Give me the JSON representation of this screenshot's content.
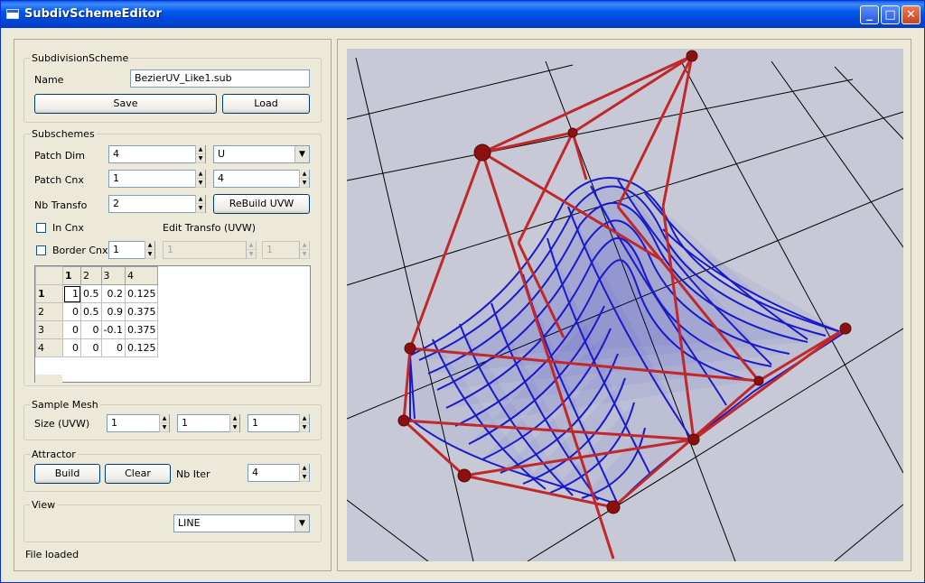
{
  "window": {
    "title": "SubdivSchemeEditor"
  },
  "subdivision_scheme": {
    "legend": "SubdivisionScheme",
    "name_label": "Name",
    "name_value": "BezierUV_Like1.sub",
    "save_label": "Save",
    "load_label": "Load"
  },
  "subschemes": {
    "legend": "Subschemes",
    "patch_dim_label": "Patch Dim",
    "patch_dim_value": "4",
    "patch_dim_axis": "U",
    "patch_cnx_label": "Patch Cnx",
    "patch_cnx_value": "1",
    "patch_cnx_value2": "4",
    "nb_transfo_label": "Nb Transfo",
    "nb_transfo_value": "2",
    "rebuild_label": "ReBuild UVW",
    "in_cnx_label": "In Cnx",
    "edit_transfo_label": "Edit Transfo (UVW)",
    "border_cnx_label": "Border Cnx",
    "border_cnx_value": "1",
    "edit_transfo_value1": "1",
    "edit_transfo_value2": "1",
    "grid": {
      "columns": [
        "1",
        "2",
        "3",
        "4"
      ],
      "rows": [
        {
          "label": "1",
          "cells": [
            "1",
            "0.5",
            "0.2",
            "0.125"
          ]
        },
        {
          "label": "2",
          "cells": [
            "0",
            "0.5",
            "0.9",
            "0.375"
          ]
        },
        {
          "label": "3",
          "cells": [
            "0",
            "0",
            "-0.1",
            "0.375"
          ]
        },
        {
          "label": "4",
          "cells": [
            "0",
            "0",
            "0",
            "0.125"
          ]
        }
      ]
    }
  },
  "sample_mesh": {
    "legend": "Sample Mesh",
    "size_label": "Size (UVW)",
    "u": "1",
    "v": "1",
    "w": "1"
  },
  "attractor": {
    "legend": "Attractor",
    "build_label": "Build",
    "clear_label": "Clear",
    "nb_iter_label": "Nb Iter",
    "nb_iter_value": "4"
  },
  "view": {
    "legend": "View",
    "mode_value": "LINE"
  },
  "status": {
    "text": "File loaded"
  },
  "colors": {
    "mesh": "#1a1ac8",
    "control_polygon": "#c0282a",
    "control_point": "#8b1010",
    "ground_grid": "#000000",
    "viewport_bg": "#c7cad6"
  }
}
